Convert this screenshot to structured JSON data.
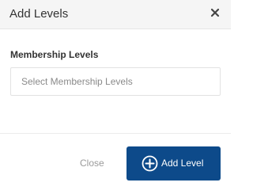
{
  "modal": {
    "title": "Add Levels",
    "close_icon": "close-icon"
  },
  "form": {
    "field_label": "Membership Levels",
    "select_placeholder": "Select Membership Levels"
  },
  "footer": {
    "close_label": "Close",
    "add_label": "Add Level",
    "add_icon": "plus-circle-icon",
    "button_color": "#0d4a8a"
  }
}
